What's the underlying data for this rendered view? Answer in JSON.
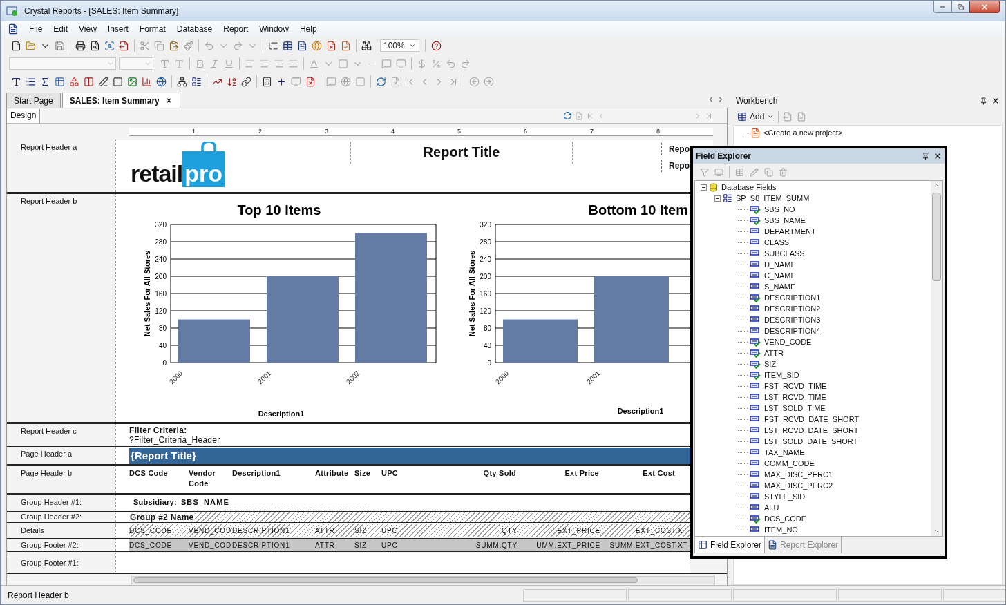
{
  "window": {
    "title": "Crystal Reports - [SALES: Item Summary]"
  },
  "menu": [
    "File",
    "Edit",
    "View",
    "Insert",
    "Format",
    "Database",
    "Report",
    "Window",
    "Help"
  ],
  "toolbar": {
    "zoom": "100%"
  },
  "document_tabs": [
    {
      "label": "Start Page",
      "selected": false
    },
    {
      "label": "SALES: Item Summary",
      "selected": true
    }
  ],
  "view_tabs": [
    {
      "label": "Design",
      "selected": true
    }
  ],
  "ruler": [
    "1",
    "2",
    "3",
    "4",
    "5",
    "6",
    "7",
    "8"
  ],
  "sections": [
    {
      "label": "Report Header a",
      "kind": "title",
      "logo": [
        "retail",
        "pro"
      ],
      "title": "Report Title",
      "fields": [
        "Repo",
        "Repo"
      ]
    },
    {
      "label": "Report Header b",
      "kind": "charts",
      "charts": [
        {
          "chart_data": {
            "type": "bar",
            "grid": true,
            "title": "Top 10 Items",
            "xlabel": "Description1",
            "ylabel": "Net Sales For All Stores",
            "categories": [
              "2000",
              "2001",
              "2002"
            ],
            "values": [
              100,
              200,
              300
            ],
            "ylim": [
              0,
              320
            ],
            "yticks": [
              0,
              40,
              80,
              120,
              160,
              200,
              240,
              280,
              320
            ]
          }
        },
        {
          "chart_data": {
            "type": "bar",
            "grid": true,
            "title": "Bottom 10 Item",
            "xlabel": "Description1",
            "ylabel": "Net Sales For All Stores",
            "categories": [
              "2000",
              "2001"
            ],
            "values": [
              100,
              200
            ],
            "ylim": [
              0,
              320
            ],
            "yticks": [
              0,
              40,
              80,
              120,
              160,
              200,
              240,
              280,
              320
            ]
          }
        }
      ]
    },
    {
      "label": "Report Header c",
      "kind": "filter",
      "caption": "Filter Criteria:",
      "value": "?Filter_Criteria_Header"
    },
    {
      "label": "Page Header a",
      "kind": "banner",
      "text": "{Report Title}"
    },
    {
      "label": "Page Header b",
      "kind": "columns",
      "cells": [
        "DCS Code",
        "Vendor Code",
        "Description1",
        "Attribute",
        "Size",
        "UPC",
        "Qty Sold",
        "Ext Price",
        "Ext Cost"
      ]
    },
    {
      "label": "Group Header #1:",
      "kind": "group",
      "caption": "Subsidiary:",
      "value": "SBS_NAME"
    },
    {
      "label": "Group Header #2:",
      "kind": "hatched",
      "text": "Group #2 Name"
    },
    {
      "label": "Details",
      "kind": "fields",
      "shaded": false,
      "cells": [
        "DCS_CODE",
        "VEND_COD",
        "DESCRIPTION1",
        "ATTR",
        "SIZ",
        "UPC",
        "QTY",
        "EXT_PRICE",
        "EXT_COST",
        "XT"
      ]
    },
    {
      "label": "Group Footer #2:",
      "kind": "fields",
      "shaded": true,
      "cells": [
        "DCS_CODE",
        "VEND_COD",
        "DESCRIPTION1",
        "ATTR",
        "SIZ",
        "UPC",
        "SUMM.QTY",
        "UMM.EXT_PRICE",
        "SUMM.EXT_COST",
        "XT"
      ]
    },
    {
      "label": "Group Footer #1:",
      "kind": "empty"
    }
  ],
  "workbench": {
    "title": "Workbench",
    "add": "Add",
    "items": [
      "<Create a new project>"
    ]
  },
  "field_explorer": {
    "title": "Field Explorer",
    "tree": [
      {
        "label": "Database Fields",
        "kind": "database",
        "expanded": true,
        "children": [
          {
            "label": "SP_S8_ITEM_SUMM",
            "kind": "table",
            "expanded": true,
            "children": [
              {
                "label": "SBS_NO",
                "kind": "field",
                "used": true
              },
              {
                "label": "SBS_NAME",
                "kind": "field",
                "used": true
              },
              {
                "label": "DEPARTMENT",
                "kind": "field",
                "used": false
              },
              {
                "label": "CLASS",
                "kind": "field",
                "used": false
              },
              {
                "label": "SUBCLASS",
                "kind": "field",
                "used": false
              },
              {
                "label": "D_NAME",
                "kind": "field",
                "used": false
              },
              {
                "label": "C_NAME",
                "kind": "field",
                "used": false
              },
              {
                "label": "S_NAME",
                "kind": "field",
                "used": false
              },
              {
                "label": "DESCRIPTION1",
                "kind": "field",
                "used": true
              },
              {
                "label": "DESCRIPTION2",
                "kind": "field",
                "used": false
              },
              {
                "label": "DESCRIPTION3",
                "kind": "field",
                "used": false
              },
              {
                "label": "DESCRIPTION4",
                "kind": "field",
                "used": false
              },
              {
                "label": "VEND_CODE",
                "kind": "field",
                "used": true
              },
              {
                "label": "ATTR",
                "kind": "field",
                "used": true
              },
              {
                "label": "SIZ",
                "kind": "field",
                "used": true
              },
              {
                "label": "ITEM_SID",
                "kind": "field",
                "used": true
              },
              {
                "label": "FST_RCVD_TIME",
                "kind": "field",
                "used": false
              },
              {
                "label": "LST_RCVD_TIME",
                "kind": "field",
                "used": false
              },
              {
                "label": "LST_SOLD_TIME",
                "kind": "field",
                "used": false
              },
              {
                "label": "FST_RCVD_DATE_SHORT",
                "kind": "field",
                "used": false
              },
              {
                "label": "LST_RCVD_DATE_SHORT",
                "kind": "field",
                "used": false
              },
              {
                "label": "LST_SOLD_DATE_SHORT",
                "kind": "field",
                "used": false
              },
              {
                "label": "TAX_NAME",
                "kind": "field",
                "used": false
              },
              {
                "label": "COMM_CODE",
                "kind": "field",
                "used": false
              },
              {
                "label": "MAX_DISC_PERC1",
                "kind": "field",
                "used": false
              },
              {
                "label": "MAX_DISC_PERC2",
                "kind": "field",
                "used": false
              },
              {
                "label": "STYLE_SID",
                "kind": "field",
                "used": false
              },
              {
                "label": "ALU",
                "kind": "field",
                "used": false
              },
              {
                "label": "DCS_CODE",
                "kind": "field",
                "used": true
              },
              {
                "label": "ITEM_NO",
                "kind": "field",
                "used": false
              }
            ]
          }
        ]
      }
    ],
    "tabs": [
      {
        "label": "Field Explorer",
        "selected": true
      },
      {
        "label": "Report Explorer",
        "selected": false
      }
    ]
  },
  "status_bar": [
    "Report Header b"
  ]
}
